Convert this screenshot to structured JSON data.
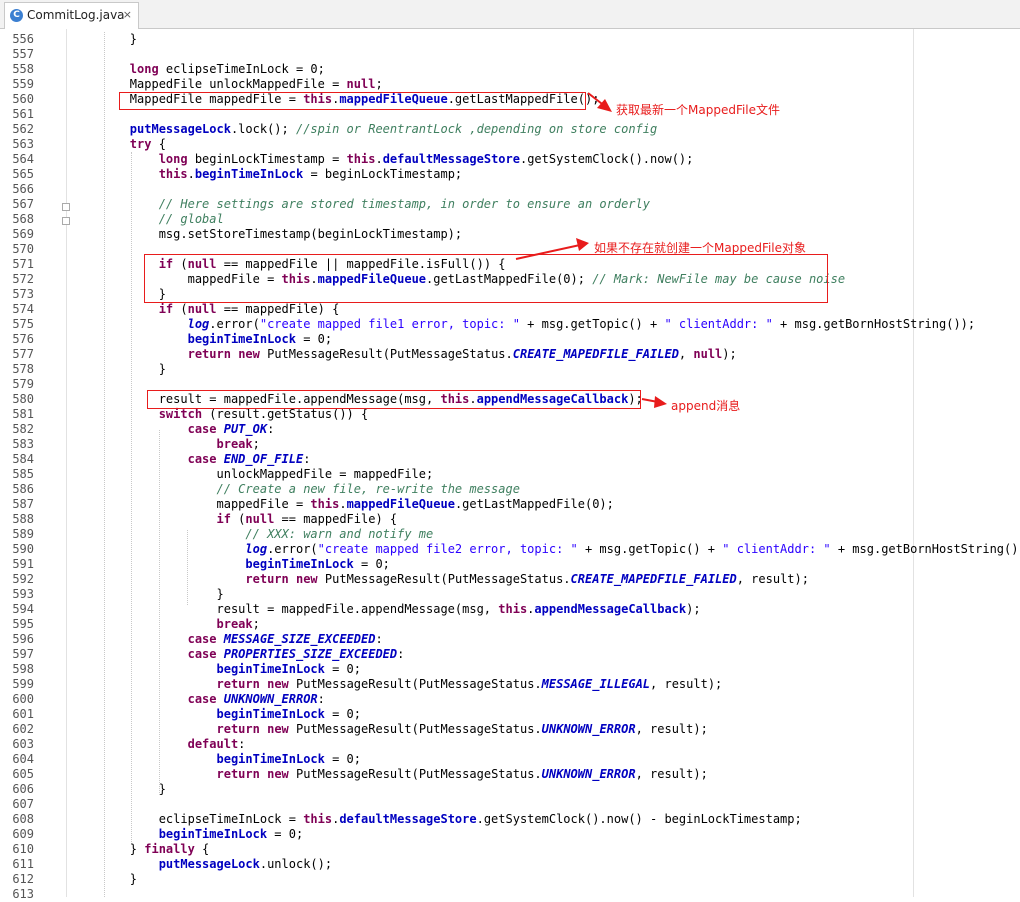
{
  "editor": {
    "tab_title": "CommitLog.java",
    "tab_close": "×",
    "tab_icon": "C"
  },
  "line_numbers": [
    "556",
    "557",
    "558",
    "559",
    "560",
    "561",
    "562",
    "563",
    "564",
    "565",
    "566",
    "567",
    "568",
    "569",
    "570",
    "571",
    "572",
    "573",
    "574",
    "575",
    "576",
    "577",
    "578",
    "579",
    "580",
    "581",
    "582",
    "583",
    "584",
    "585",
    "586",
    "587",
    "588",
    "589",
    "590",
    "591",
    "592",
    "593",
    "594",
    "595",
    "596",
    "597",
    "598",
    "599",
    "600",
    "601",
    "602",
    "603",
    "604",
    "605",
    "606",
    "607",
    "608",
    "609",
    "610",
    "611",
    "612",
    "613"
  ],
  "code_lines": [
    [
      [
        "p",
        "        }"
      ]
    ],
    [],
    [
      [
        "p",
        "        "
      ],
      [
        "k",
        "long"
      ],
      [
        "p",
        " eclipseTimeInLock = 0;"
      ]
    ],
    [
      [
        "p",
        "        MappedFile unlockMappedFile = "
      ],
      [
        "k",
        "null"
      ],
      [
        "p",
        ";"
      ]
    ],
    [
      [
        "p",
        "        MappedFile mappedFile = "
      ],
      [
        "k",
        "this"
      ],
      [
        "p",
        "."
      ],
      [
        "f",
        "mappedFileQueue"
      ],
      [
        "p",
        ".getLastMappedFile();"
      ]
    ],
    [],
    [
      [
        "p",
        "        "
      ],
      [
        "f",
        "putMessageLock"
      ],
      [
        "p",
        ".lock(); "
      ],
      [
        "c",
        "//spin or ReentrantLock ,depending on store config"
      ]
    ],
    [
      [
        "p",
        "        "
      ],
      [
        "k",
        "try"
      ],
      [
        "p",
        " {"
      ]
    ],
    [
      [
        "p",
        "            "
      ],
      [
        "k",
        "long"
      ],
      [
        "p",
        " beginLockTimestamp = "
      ],
      [
        "k",
        "this"
      ],
      [
        "p",
        "."
      ],
      [
        "f",
        "defaultMessageStore"
      ],
      [
        "p",
        ".getSystemClock().now();"
      ]
    ],
    [
      [
        "p",
        "            "
      ],
      [
        "k",
        "this"
      ],
      [
        "p",
        "."
      ],
      [
        "f",
        "beginTimeInLock"
      ],
      [
        "p",
        " = beginLockTimestamp;"
      ]
    ],
    [],
    [
      [
        "p",
        "            "
      ],
      [
        "c",
        "// Here settings are stored timestamp, in order to ensure an orderly"
      ]
    ],
    [
      [
        "p",
        "            "
      ],
      [
        "c",
        "// global"
      ]
    ],
    [
      [
        "p",
        "            msg.setStoreTimestamp(beginLockTimestamp);"
      ]
    ],
    [],
    [
      [
        "p",
        "            "
      ],
      [
        "k",
        "if"
      ],
      [
        "p",
        " ("
      ],
      [
        "k",
        "null"
      ],
      [
        "p",
        " == mappedFile || mappedFile.isFull()) {"
      ]
    ],
    [
      [
        "p",
        "                mappedFile = "
      ],
      [
        "k",
        "this"
      ],
      [
        "p",
        "."
      ],
      [
        "f",
        "mappedFileQueue"
      ],
      [
        "p",
        ".getLastMappedFile(0); "
      ],
      [
        "c",
        "// Mark: NewFile may be cause noise"
      ]
    ],
    [
      [
        "p",
        "            }"
      ]
    ],
    [
      [
        "p",
        "            "
      ],
      [
        "k",
        "if"
      ],
      [
        "p",
        " ("
      ],
      [
        "k",
        "null"
      ],
      [
        "p",
        " == mappedFile) {"
      ]
    ],
    [
      [
        "p",
        "                "
      ],
      [
        "sf",
        "log"
      ],
      [
        "p",
        ".error("
      ],
      [
        "s",
        "\"create mapped file1 error, topic: \""
      ],
      [
        "p",
        " + msg.getTopic() + "
      ],
      [
        "s",
        "\" clientAddr: \""
      ],
      [
        "p",
        " + msg.getBornHostString());"
      ]
    ],
    [
      [
        "p",
        "                "
      ],
      [
        "f",
        "beginTimeInLock"
      ],
      [
        "p",
        " = 0;"
      ]
    ],
    [
      [
        "p",
        "                "
      ],
      [
        "k",
        "return"
      ],
      [
        "p",
        " "
      ],
      [
        "k",
        "new"
      ],
      [
        "p",
        " PutMessageResult(PutMessageStatus."
      ],
      [
        "e",
        "CREATE_MAPEDFILE_FAILED"
      ],
      [
        "p",
        ", "
      ],
      [
        "k",
        "null"
      ],
      [
        "p",
        ");"
      ]
    ],
    [
      [
        "p",
        "            }"
      ]
    ],
    [],
    [
      [
        "p",
        "            result = mappedFile.appendMessage(msg, "
      ],
      [
        "k",
        "this"
      ],
      [
        "p",
        "."
      ],
      [
        "f",
        "appendMessageCallback"
      ],
      [
        "p",
        ");"
      ]
    ],
    [
      [
        "p",
        "            "
      ],
      [
        "k",
        "switch"
      ],
      [
        "p",
        " (result.getStatus()) {"
      ]
    ],
    [
      [
        "p",
        "                "
      ],
      [
        "k",
        "case"
      ],
      [
        "p",
        " "
      ],
      [
        "e",
        "PUT_OK"
      ],
      [
        "p",
        ":"
      ]
    ],
    [
      [
        "p",
        "                    "
      ],
      [
        "k",
        "break"
      ],
      [
        "p",
        ";"
      ]
    ],
    [
      [
        "p",
        "                "
      ],
      [
        "k",
        "case"
      ],
      [
        "p",
        " "
      ],
      [
        "e",
        "END_OF_FILE"
      ],
      [
        "p",
        ":"
      ]
    ],
    [
      [
        "p",
        "                    unlockMappedFile = mappedFile;"
      ]
    ],
    [
      [
        "p",
        "                    "
      ],
      [
        "c",
        "// Create a new file, re-write the message"
      ]
    ],
    [
      [
        "p",
        "                    mappedFile = "
      ],
      [
        "k",
        "this"
      ],
      [
        "p",
        "."
      ],
      [
        "f",
        "mappedFileQueue"
      ],
      [
        "p",
        ".getLastMappedFile(0);"
      ]
    ],
    [
      [
        "p",
        "                    "
      ],
      [
        "k",
        "if"
      ],
      [
        "p",
        " ("
      ],
      [
        "k",
        "null"
      ],
      [
        "p",
        " == mappedFile) {"
      ]
    ],
    [
      [
        "p",
        "                        "
      ],
      [
        "c",
        "// XXX: warn and notify me"
      ]
    ],
    [
      [
        "p",
        "                        "
      ],
      [
        "sf",
        "log"
      ],
      [
        "p",
        ".error("
      ],
      [
        "s",
        "\"create mapped file2 error, topic: \""
      ],
      [
        "p",
        " + msg.getTopic() + "
      ],
      [
        "s",
        "\" clientAddr: \""
      ],
      [
        "p",
        " + msg.getBornHostString());"
      ]
    ],
    [
      [
        "p",
        "                        "
      ],
      [
        "f",
        "beginTimeInLock"
      ],
      [
        "p",
        " = 0;"
      ]
    ],
    [
      [
        "p",
        "                        "
      ],
      [
        "k",
        "return"
      ],
      [
        "p",
        " "
      ],
      [
        "k",
        "new"
      ],
      [
        "p",
        " PutMessageResult(PutMessageStatus."
      ],
      [
        "e",
        "CREATE_MAPEDFILE_FAILED"
      ],
      [
        "p",
        ", result);"
      ]
    ],
    [
      [
        "p",
        "                    }"
      ]
    ],
    [
      [
        "p",
        "                    result = mappedFile.appendMessage(msg, "
      ],
      [
        "k",
        "this"
      ],
      [
        "p",
        "."
      ],
      [
        "f",
        "appendMessageCallback"
      ],
      [
        "p",
        ");"
      ]
    ],
    [
      [
        "p",
        "                    "
      ],
      [
        "k",
        "break"
      ],
      [
        "p",
        ";"
      ]
    ],
    [
      [
        "p",
        "                "
      ],
      [
        "k",
        "case"
      ],
      [
        "p",
        " "
      ],
      [
        "e",
        "MESSAGE_SIZE_EXCEEDED"
      ],
      [
        "p",
        ":"
      ]
    ],
    [
      [
        "p",
        "                "
      ],
      [
        "k",
        "case"
      ],
      [
        "p",
        " "
      ],
      [
        "e",
        "PROPERTIES_SIZE_EXCEEDED"
      ],
      [
        "p",
        ":"
      ]
    ],
    [
      [
        "p",
        "                    "
      ],
      [
        "f",
        "beginTimeInLock"
      ],
      [
        "p",
        " = 0;"
      ]
    ],
    [
      [
        "p",
        "                    "
      ],
      [
        "k",
        "return"
      ],
      [
        "p",
        " "
      ],
      [
        "k",
        "new"
      ],
      [
        "p",
        " PutMessageResult(PutMessageStatus."
      ],
      [
        "e",
        "MESSAGE_ILLEGAL"
      ],
      [
        "p",
        ", result);"
      ]
    ],
    [
      [
        "p",
        "                "
      ],
      [
        "k",
        "case"
      ],
      [
        "p",
        " "
      ],
      [
        "e",
        "UNKNOWN_ERROR"
      ],
      [
        "p",
        ":"
      ]
    ],
    [
      [
        "p",
        "                    "
      ],
      [
        "f",
        "beginTimeInLock"
      ],
      [
        "p",
        " = 0;"
      ]
    ],
    [
      [
        "p",
        "                    "
      ],
      [
        "k",
        "return"
      ],
      [
        "p",
        " "
      ],
      [
        "k",
        "new"
      ],
      [
        "p",
        " PutMessageResult(PutMessageStatus."
      ],
      [
        "e",
        "UNKNOWN_ERROR"
      ],
      [
        "p",
        ", result);"
      ]
    ],
    [
      [
        "p",
        "                "
      ],
      [
        "k",
        "default"
      ],
      [
        "p",
        ":"
      ]
    ],
    [
      [
        "p",
        "                    "
      ],
      [
        "f",
        "beginTimeInLock"
      ],
      [
        "p",
        " = 0;"
      ]
    ],
    [
      [
        "p",
        "                    "
      ],
      [
        "k",
        "return"
      ],
      [
        "p",
        " "
      ],
      [
        "k",
        "new"
      ],
      [
        "p",
        " PutMessageResult(PutMessageStatus."
      ],
      [
        "e",
        "UNKNOWN_ERROR"
      ],
      [
        "p",
        ", result);"
      ]
    ],
    [
      [
        "p",
        "            }"
      ]
    ],
    [],
    [
      [
        "p",
        "            eclipseTimeInLock = "
      ],
      [
        "k",
        "this"
      ],
      [
        "p",
        "."
      ],
      [
        "f",
        "defaultMessageStore"
      ],
      [
        "p",
        ".getSystemClock().now() - beginLockTimestamp;"
      ]
    ],
    [
      [
        "p",
        "            "
      ],
      [
        "f",
        "beginTimeInLock"
      ],
      [
        "p",
        " = 0;"
      ]
    ],
    [
      [
        "p",
        "        } "
      ],
      [
        "k",
        "finally"
      ],
      [
        "p",
        " {"
      ]
    ],
    [
      [
        "p",
        "            "
      ],
      [
        "f",
        "putMessageLock"
      ],
      [
        "p",
        ".unlock();"
      ]
    ],
    [
      [
        "p",
        "        }"
      ]
    ],
    []
  ],
  "annotations": {
    "a1": "获取最新一个MappedFile文件",
    "a2": "如果不存在就创建一个MappedFile对象",
    "a3": "append消息"
  },
  "colors": {
    "annotation": "#e81c1c",
    "keyword": "#7f0055",
    "field": "#0000c0",
    "comment": "#3f7f5f",
    "string": "#2a00ff"
  }
}
